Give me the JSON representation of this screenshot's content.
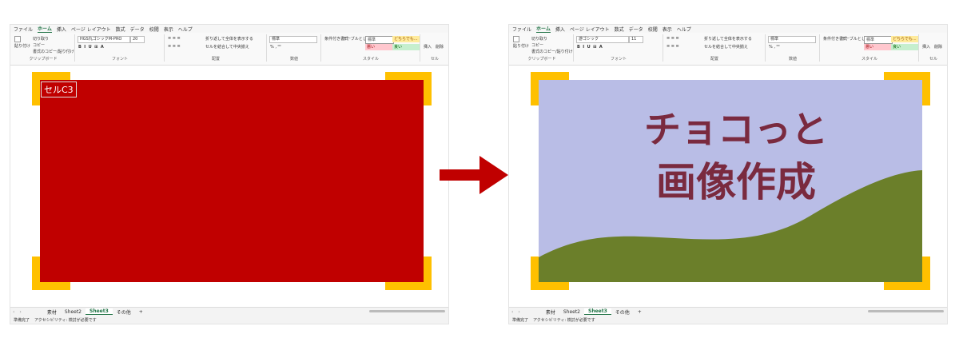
{
  "menu": [
    "ファイル",
    "ホーム",
    "挿入",
    "ページ レイアウト",
    "数式",
    "データ",
    "校閲",
    "表示",
    "ヘルプ"
  ],
  "menu_active_index": 1,
  "ribbon": {
    "clipboard": {
      "paste": "貼り付け",
      "cut": "切り取り",
      "copy": "コピー",
      "format_painter": "書式のコピー/貼り付け",
      "caption": "クリップボード"
    },
    "font": {
      "caption": "フォント",
      "size": "20"
    },
    "alignment": {
      "wrap": "折り返して全体を表示する",
      "merge": "セルを結合して中央揃え",
      "caption": "配置"
    },
    "number": {
      "format": "標準",
      "caption": "数値"
    },
    "styles": {
      "conditional": "条件付き書式",
      "table": "テーブルとして書式設定",
      "normal": "標準",
      "neutral": "どちらでも...",
      "bad": "悪い",
      "good": "良い",
      "caption": "スタイル"
    },
    "cells": {
      "insert": "挿入",
      "delete": "削除",
      "caption": "セル"
    }
  },
  "left": {
    "font_name": "HGS丸ゴシックM-PRO",
    "cell_label": "セルC3"
  },
  "right": {
    "font_name": "游ゴシック",
    "font_size": "11",
    "title_line1": "チョコっと",
    "title_line2": "画像作成"
  },
  "sheet_tabs": [
    "素材",
    "Sheet2",
    "Sheet3",
    "その他"
  ],
  "sheet_active_index": 2,
  "status": {
    "ready": "準備完了",
    "accessibility": "アクセシビリティ: 検討が必要です"
  },
  "colors": {
    "excel_green": "#217346",
    "red_fill": "#c00000",
    "handle": "#ffc000",
    "sky": "#b9bde6",
    "hill": "#6b7f2a",
    "title_text": "#7a2a3f",
    "arrow": "#c00000"
  }
}
